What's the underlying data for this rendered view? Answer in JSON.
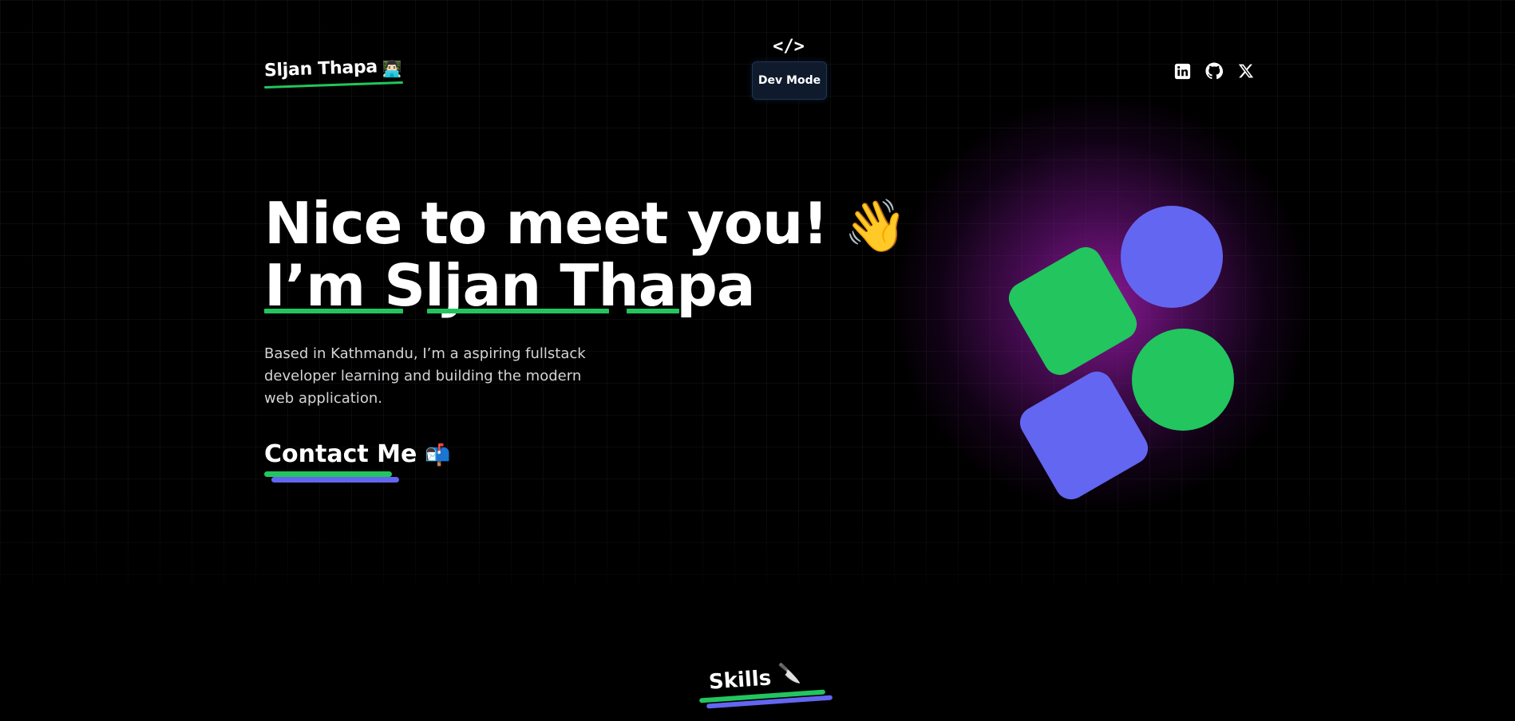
{
  "header": {
    "brand_name": "Sljan Thapa",
    "brand_emoji": "👨🏻‍💻",
    "dev_icon": "</>",
    "dev_mode_label": "Dev Mode",
    "social_icons": [
      "linkedin-icon",
      "github-icon",
      "x-icon"
    ]
  },
  "hero": {
    "headline_line1": "Nice to meet you!",
    "headline_emoji": "👋",
    "headline_line2": "I’m Sljan Thapa",
    "bio": "Based in Kathmandu, I’m a aspiring fullstack developer learning and building the modern web application.",
    "contact_label": "Contact Me",
    "contact_emoji": "📬"
  },
  "skills": {
    "title": "Skills",
    "emoji": "🔪"
  },
  "colors": {
    "background": "#000000",
    "accent_green": "#22c55e",
    "accent_indigo": "#6366f1",
    "glow_purple": "#a21caf",
    "text_muted": "#d4d4d8"
  }
}
